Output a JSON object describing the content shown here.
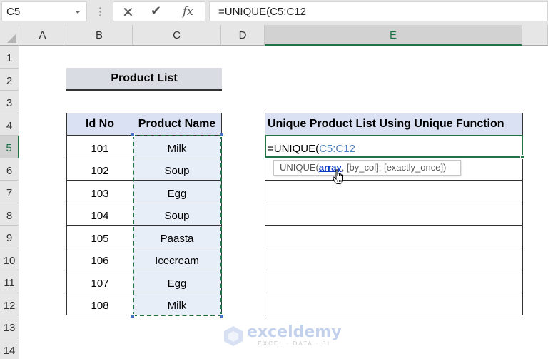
{
  "formula_bar": {
    "name_box": "C5",
    "cancel_icon": "✕",
    "enter_icon": "✔",
    "fx_label": "fx",
    "formula": "=UNIQUE(C5:C12"
  },
  "columns": [
    "A",
    "B",
    "C",
    "D",
    "E"
  ],
  "selected_column": "E",
  "rows": [
    "1",
    "2",
    "3",
    "4",
    "5",
    "6",
    "7",
    "8",
    "9",
    "10",
    "11",
    "12",
    "13",
    "14"
  ],
  "selected_row": "5",
  "product_list": {
    "title": "Product List",
    "headers": [
      "Id No",
      "Product Name"
    ],
    "items": [
      {
        "id": "101",
        "name": "Milk"
      },
      {
        "id": "102",
        "name": "Soup"
      },
      {
        "id": "103",
        "name": "Egg"
      },
      {
        "id": "104",
        "name": "Soup"
      },
      {
        "id": "105",
        "name": "Paasta"
      },
      {
        "id": "106",
        "name": "Icecream"
      },
      {
        "id": "107",
        "name": "Egg"
      },
      {
        "id": "108",
        "name": "Milk"
      }
    ]
  },
  "unique_list": {
    "header": "Unique Product List Using Unique Function",
    "editing_formula_prefix": "=UNIQUE(",
    "editing_formula_ref": "C5:C12"
  },
  "tooltip": {
    "fn": "UNIQUE(",
    "arg_active": "array",
    "rest": ", [by_col], [exactly_once])"
  },
  "watermark": {
    "brand": "exceldemy",
    "tagline": "EXCEL · DATA · BI"
  },
  "colors": {
    "excel_green": "#217346",
    "header_fill": "#d9e1f2",
    "title_fill": "#d9dce3",
    "ref_blue": "#4a7fc1"
  }
}
